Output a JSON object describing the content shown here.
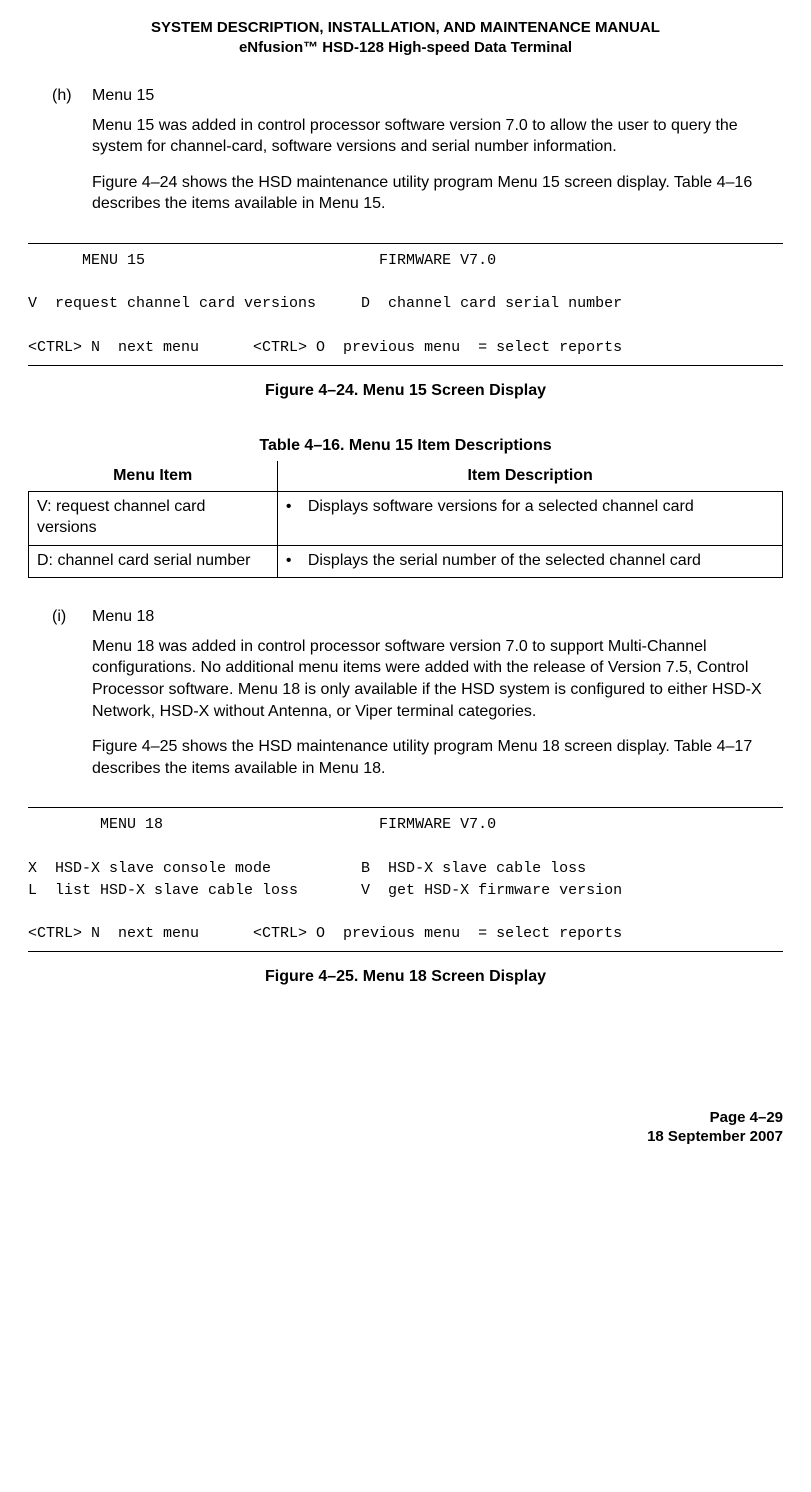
{
  "header": {
    "line1": "SYSTEM DESCRIPTION, INSTALLATION, AND MAINTENANCE MANUAL",
    "line2": "eNfusion™ HSD-128 High-speed Data Terminal"
  },
  "sections": [
    {
      "label": "(h)",
      "title": "Menu 15",
      "paras": [
        "Menu 15 was added in control processor software version 7.0 to allow the user to query the system for channel-card, software versions and serial number information.",
        "Figure 4–24 shows the HSD maintenance utility program Menu 15 screen display. Table 4–16 describes the items available in Menu 15."
      ]
    },
    {
      "label": "(i)",
      "title": "Menu 18",
      "paras": [
        "Menu 18 was added in control processor software version 7.0 to support Multi-Channel configurations. No additional menu items were added with the release of Version 7.5, Control Processor software. Menu 18 is only available if the HSD system is configured to either HSD-X Network, HSD-X without Antenna, or Viper terminal categories.",
        "Figure 4–25 shows the HSD maintenance utility program Menu 18 screen display. Table 4–17 describes the items available in Menu 18."
      ]
    }
  ],
  "terminals": {
    "menu15": "      MENU 15                          FIRMWARE V7.0\n\nV  request channel card versions     D  channel card serial number\n\n<CTRL> N  next menu      <CTRL> O  previous menu  = select reports",
    "menu18": "        MENU 18                        FIRMWARE V7.0\n\nX  HSD-X slave console mode          B  HSD-X slave cable loss\nL  list HSD-X slave cable loss       V  get HSD-X firmware version\n\n<CTRL> N  next menu      <CTRL> O  previous menu  = select reports"
  },
  "captions": {
    "fig15": "Figure 4–24. Menu 15 Screen Display",
    "tbl16": "Table 4–16. Menu 15 Item Descriptions",
    "fig18": "Figure 4–25. Menu 18 Screen Display"
  },
  "table": {
    "head": {
      "c1": "Menu Item",
      "c2": "Item Description"
    },
    "rows": [
      {
        "item": "V: request channel card versions",
        "desc": "Displays software versions for a selected channel card"
      },
      {
        "item": "D: channel card serial number",
        "desc": "Displays the serial number of the selected channel card"
      }
    ]
  },
  "footer": {
    "page": "Page 4–29",
    "date": "18 September 2007"
  },
  "bullet": "•"
}
